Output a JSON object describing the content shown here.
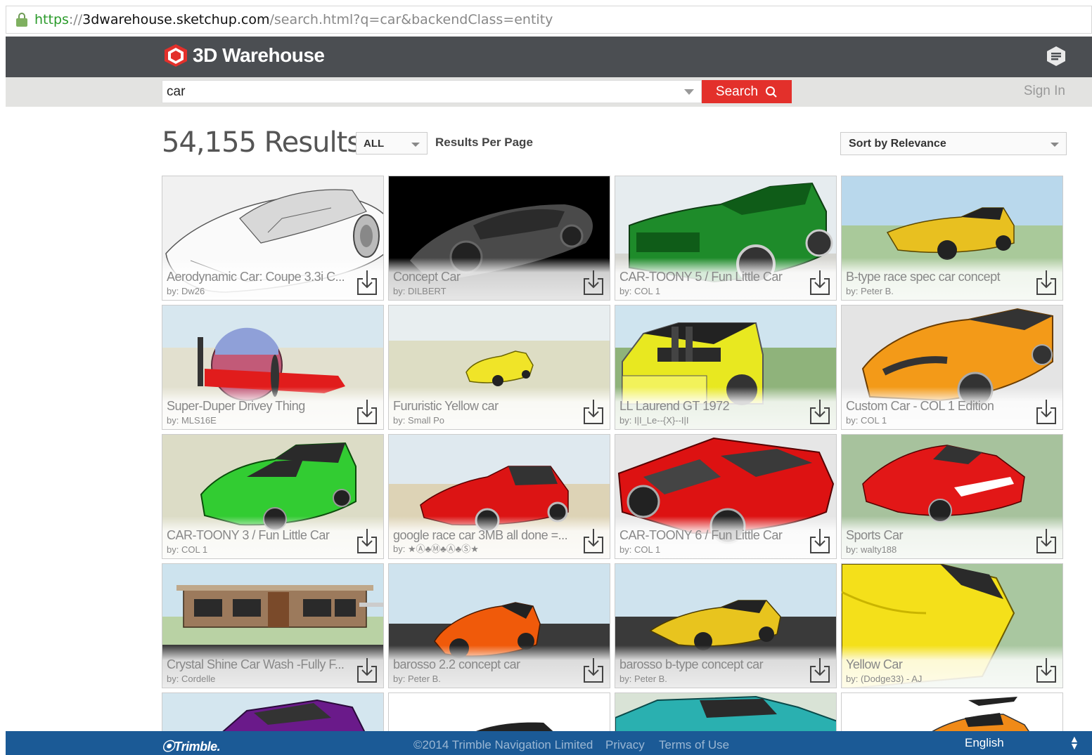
{
  "browser": {
    "url_scheme": "https",
    "url_sep": "://",
    "url_host": "3dwarehouse.sketchup.com",
    "url_path": "/search.html?q=car&backendClass=entity"
  },
  "header": {
    "brand": "3D Warehouse",
    "brand_color": "#e3302b",
    "bar_color": "#4b4e52"
  },
  "search": {
    "value": "car",
    "button_label": "Search",
    "sign_in": "Sign In"
  },
  "results": {
    "count_text": "54,155 Results",
    "per_page_value": "ALL",
    "per_page_label": "Results Per Page",
    "sort_value": "Sort by Relevance"
  },
  "models": [
    {
      "title": "Aerodynamic Car: Coupe 3.3i C...",
      "author": "by: Dw26"
    },
    {
      "title": "Concept Car",
      "author": "by: DILBERT"
    },
    {
      "title": "CAR-TOONY 5 / Fun Little Car",
      "author": "by: COL 1"
    },
    {
      "title": "B-type race spec car concept",
      "author": "by: Peter B."
    },
    {
      "title": "Super-Duper Drivey Thing",
      "author": "by: MLS16E"
    },
    {
      "title": "Fururistic Yellow car",
      "author": "by: Small Po"
    },
    {
      "title": "LL Laurend GT 1972",
      "author": "by: I|I_Le--{X}--I|I"
    },
    {
      "title": "Custom Car - COL 1 Edition",
      "author": "by: COL 1"
    },
    {
      "title": "CAR-TOONY 3 / Fun Little Car",
      "author": "by: COL 1"
    },
    {
      "title": "google race car 3MB all done =...",
      "author": "by: ★Ⓐ♣Ⓜ♣Ⓐ♣Ⓢ★"
    },
    {
      "title": "CAR-TOONY 6 / Fun Little Car",
      "author": "by: COL 1"
    },
    {
      "title": "Sports Car",
      "author": "by: walty188"
    },
    {
      "title": "Crystal Shine Car Wash -Fully F...",
      "author": "by: Cordelle"
    },
    {
      "title": "barosso 2.2 concept car",
      "author": "by: Peter B."
    },
    {
      "title": "barosso b-type concept car",
      "author": "by: Peter B."
    },
    {
      "title": "Yellow Car",
      "author": "by: (Dodge33) - AJ"
    }
  ],
  "footer": {
    "company": "⦿Trimble.",
    "copyright": "©2014 Trimble Navigation Limited",
    "privacy": "Privacy",
    "terms": "Terms of Use",
    "language": "English",
    "bar_color": "#1b5a96"
  }
}
